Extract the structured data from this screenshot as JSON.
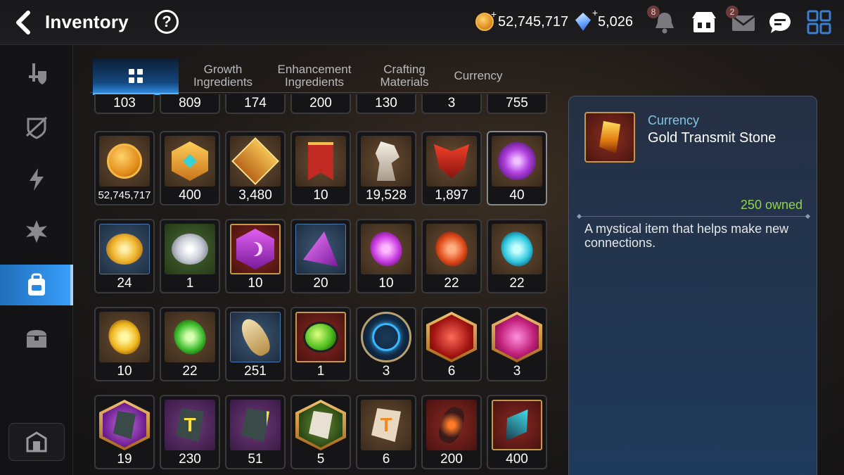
{
  "header": {
    "title": "Inventory",
    "gold": "52,745,717",
    "crystals": "5,026",
    "notifications_badge": "8",
    "mail_badge": "2",
    "icons": [
      "back-arrow-icon",
      "help-icon",
      "gold-coin-icon",
      "crystal-icon",
      "bell-icon",
      "shop-icon",
      "mail-icon",
      "chat-icon",
      "menu-grid-icon"
    ]
  },
  "sidebar": {
    "items": [
      {
        "icon": "equipment-icon"
      },
      {
        "icon": "artifact-icon"
      },
      {
        "icon": "catalyst-icon"
      },
      {
        "icon": "material-icon"
      },
      {
        "icon": "bag-icon",
        "active": true
      },
      {
        "icon": "chest-icon"
      }
    ],
    "bottom_icon": "storage-icon"
  },
  "tabs": [
    {
      "label": "",
      "icon": "all-items-icon",
      "active": true
    },
    {
      "label": "Growth\nIngredients"
    },
    {
      "label": "Enhancement\nIngredients"
    },
    {
      "label": "Crafting\nMaterials"
    },
    {
      "label": "Currency"
    }
  ],
  "partial_row": [
    "103",
    "809",
    "174",
    "200",
    "130",
    "3",
    "755"
  ],
  "rows": [
    [
      {
        "count": "52,745,717",
        "icon": "gold-coin-icon",
        "bg": "brown"
      },
      {
        "count": "400",
        "icon": "gold-hexagon-icon",
        "bg": "brown"
      },
      {
        "count": "3,480",
        "icon": "fist-emblem-icon",
        "bg": "brown"
      },
      {
        "count": "10",
        "icon": "banner-icon",
        "bg": "brown"
      },
      {
        "count": "19,528",
        "icon": "horse-statue-icon",
        "bg": "brown"
      },
      {
        "count": "1,897",
        "icon": "red-mask-icon",
        "bg": "brown"
      },
      {
        "count": "40",
        "icon": "purple-flower-icon",
        "bg": "brown"
      }
    ],
    [
      {
        "count": "24",
        "icon": "gold-flower-icon",
        "bg": "blue"
      },
      {
        "count": "1",
        "icon": "silver-flower-icon",
        "bg": "green"
      },
      {
        "count": "10",
        "icon": "purple-moon-gem-icon",
        "bg": "red"
      },
      {
        "count": "20",
        "icon": "purple-moon-shard-icon",
        "bg": "blue"
      },
      {
        "count": "10",
        "icon": "purple-rune-icon",
        "bg": "brown"
      },
      {
        "count": "22",
        "icon": "red-rune-icon",
        "bg": "brown"
      },
      {
        "count": "22",
        "icon": "cyan-rune-icon",
        "bg": "brown"
      }
    ],
    [
      {
        "count": "10",
        "icon": "yellow-rune-icon",
        "bg": "brown"
      },
      {
        "count": "22",
        "icon": "green-rune-icon",
        "bg": "brown"
      },
      {
        "count": "251",
        "icon": "feather-charm-icon",
        "bg": "blue"
      },
      {
        "count": "1",
        "icon": "green-potion-icon",
        "bg": "red"
      },
      {
        "count": "3",
        "icon": "blue-circuit-orb-icon",
        "bg": "blue-round"
      },
      {
        "count": "6",
        "icon": "red-crystal-hex-icon",
        "bg": "red-hex"
      },
      {
        "count": "3",
        "icon": "pink-potion-hex-icon",
        "bg": "red-hex"
      }
    ],
    [
      {
        "count": "19",
        "icon": "purple-spark-stone-icon",
        "bg": "purple-hex"
      },
      {
        "count": "230",
        "icon": "yellow-mark-stone-icon",
        "bg": "purple"
      },
      {
        "count": "51",
        "icon": "green-spark-stone-icon",
        "bg": "purple"
      },
      {
        "count": "5",
        "icon": "white-spark-stone-icon",
        "bg": "green-hex"
      },
      {
        "count": "6",
        "icon": "beige-stone-icon",
        "bg": "brown"
      },
      {
        "count": "200",
        "icon": "red-gem-shard-icon",
        "bg": "red"
      },
      {
        "count": "400",
        "icon": "cyan-shard-icon",
        "bg": "red"
      }
    ]
  ],
  "detail": {
    "category": "Currency",
    "name": "Gold Transmit Stone",
    "owned": "250 owned",
    "description": "A mystical item that helps make new connections.",
    "icon": "gold-transmit-stone-icon"
  }
}
